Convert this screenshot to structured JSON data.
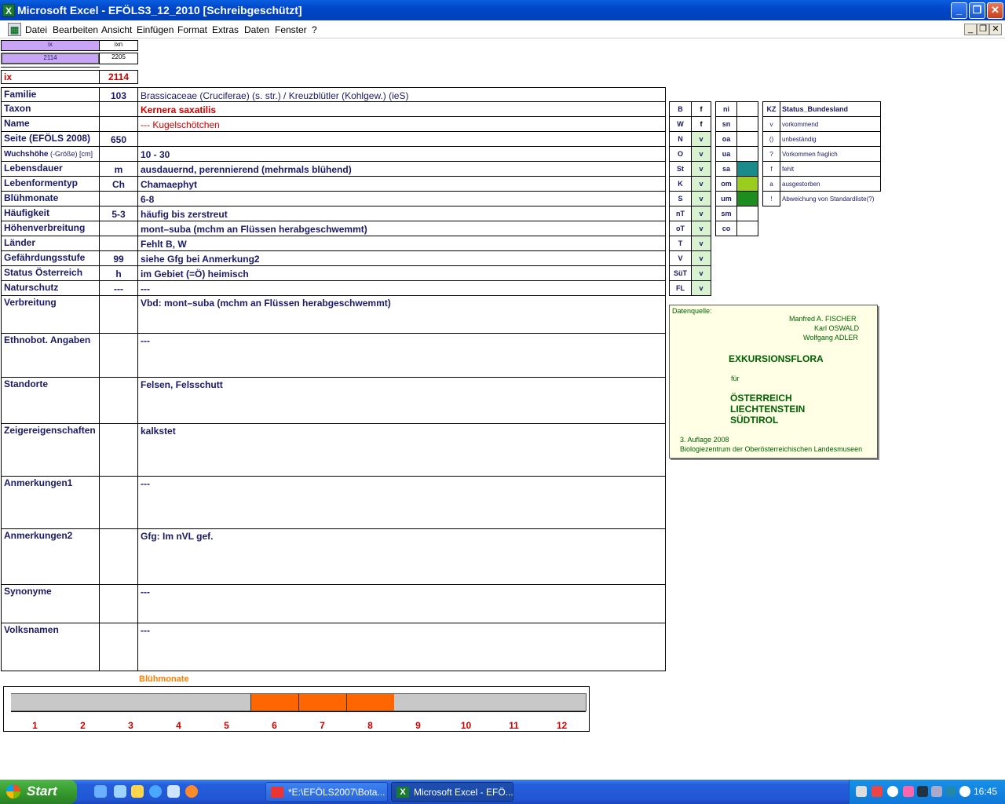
{
  "window": {
    "title": "Microsoft Excel - EFÖLS3_12_2010  [Schreibgeschützt]",
    "app_icon": "excel-icon",
    "buttons": [
      "minimize",
      "restore",
      "close"
    ]
  },
  "menu": {
    "items": [
      "Datei",
      "Bearbeiten",
      "Ansicht",
      "Einfügen",
      "Format",
      "Extras",
      "Daten",
      "Fenster",
      "?"
    ]
  },
  "topcells": {
    "ix_head": "ix",
    "ixn_head": "ixn",
    "ix_val": "2114",
    "ixn_val": "2205",
    "ix_label": "ix",
    "ix_number": "2114"
  },
  "rows": [
    {
      "label": "Familie",
      "code": "103",
      "value": "Brassicaceae (Cruciferae) (s. str.)  /  Kreuzblütler (Kohlgew.) (ieS)"
    },
    {
      "label": "Taxon",
      "code": "",
      "value": "Kernera saxatilis"
    },
    {
      "label": "Name",
      "code": "",
      "value": "--- Kugelschötchen"
    },
    {
      "label": "Seite (EFÖLS 2008)",
      "code": "650",
      "value": ""
    },
    {
      "label": "Wuchshöhe",
      "label_suffix": " (-Größe) [cm]",
      "code": "",
      "value": " 10 - 30"
    },
    {
      "label": "Lebensdauer",
      "code": "m",
      "value": "ausdauernd, perennierend (mehrmals blühend)"
    },
    {
      "label": "Lebenformentyp",
      "code": "Ch",
      "value": "Chamaephyt"
    },
    {
      "label": "Blühmonate",
      "code": "",
      "value": " 6-8"
    },
    {
      "label": "Häufigkeit",
      "code": "5-3",
      "value": "häufig bis zerstreut"
    },
    {
      "label": "Höhenverbreitung",
      "code": "",
      "value": "mont–suba (mchm an Flüssen herabgeschwemmt)"
    },
    {
      "label": "Länder",
      "code": "",
      "value": "Fehlt B, W"
    },
    {
      "label": "Gefährdungsstufe",
      "code": "99",
      "value": "siehe Gfg bei Anmerkung2"
    },
    {
      "label": "Status Österreich",
      "code": "h",
      "value": "im Gebiet (=Ö) heimisch"
    },
    {
      "label": "Naturschutz",
      "code": "---",
      "value": " ---"
    },
    {
      "label": "Verbreitung",
      "code": "",
      "value": "Vbd: mont–suba (mchm an Flüssen herabgeschwemmt)"
    },
    {
      "label": "Ethnobot. Angaben",
      "code": "",
      "value": "---"
    },
    {
      "label": "Standorte",
      "code": "",
      "value": "Felsen, Felsschutt"
    },
    {
      "label": "Zeigereigenschaften",
      "code": "",
      "value": "kalkstet"
    },
    {
      "label": "Anmerkungen1",
      "code": "",
      "value": "---"
    },
    {
      "label": "Anmerkungen2",
      "code": "",
      "value": "Gfg:  Im nVL gef."
    },
    {
      "label": "Synonyme",
      "code": "",
      "value": "---"
    },
    {
      "label": "Volksnamen",
      "code": "",
      "value": "---"
    }
  ],
  "bundeslaender": [
    {
      "code": "B",
      "val": "f"
    },
    {
      "code": "W",
      "val": "f"
    },
    {
      "code": "N",
      "val": "v"
    },
    {
      "code": "O",
      "val": "v"
    },
    {
      "code": "St",
      "val": "v"
    },
    {
      "code": "K",
      "val": "v"
    },
    {
      "code": "S",
      "val": "v"
    },
    {
      "code": "nT",
      "val": "v"
    },
    {
      "code": "oT",
      "val": "v"
    },
    {
      "code": "T",
      "val": "v"
    },
    {
      "code": "V",
      "val": "v"
    },
    {
      "code": "SüT",
      "val": "v"
    },
    {
      "code": "FL",
      "val": "v"
    }
  ],
  "hoehenstufen": [
    {
      "code": "ni",
      "color": ""
    },
    {
      "code": "sn",
      "color": ""
    },
    {
      "code": "oa",
      "color": ""
    },
    {
      "code": "ua",
      "color": ""
    },
    {
      "code": "sa",
      "color": "#1b8a8a"
    },
    {
      "code": "om",
      "color": "#9acd1e"
    },
    {
      "code": "um",
      "color": "#1e8c1e"
    },
    {
      "code": "sm",
      "color": ""
    },
    {
      "code": "co",
      "color": ""
    }
  ],
  "status_legend": {
    "head_kz": "KZ",
    "head_label": "Status_Bundesland",
    "items": [
      {
        "kz": "v",
        "text": "vorkommend"
      },
      {
        "kz": "()",
        "text": "unbeständig"
      },
      {
        "kz": "?",
        "text": "Vorkommen fraglich"
      },
      {
        "kz": "f",
        "text": "fehlt"
      },
      {
        "kz": "a",
        "text": "ausgestorben"
      },
      {
        "kz": "!",
        "text": "Abweichung von Standardliste(?)"
      }
    ]
  },
  "source": {
    "heading": "Datenquelle:",
    "authors": [
      "Manfred A. FISCHER",
      "Karl OSWALD",
      "Wolfgang ADLER"
    ],
    "title": "EXKURSIONSFLORA",
    "fuer": "für",
    "countries": [
      "ÖSTERREICH",
      "LIECHTENSTEIN",
      "SÜDTIROL"
    ],
    "edition": "3. Auflage 2008",
    "publisher": "Biologiezentrum der Oberösterreichischen Landesmuseen"
  },
  "bluete": {
    "title": "Blühmonate",
    "months": [
      "1",
      "2",
      "3",
      "4",
      "5",
      "6",
      "7",
      "8",
      "9",
      "10",
      "11",
      "12"
    ],
    "flowering": [
      6,
      7,
      8
    ],
    "on_color": "#ff6600",
    "off_color": "#c8c8c8"
  },
  "taskbar": {
    "start": "Start",
    "tasks": [
      "*E:\\EFÖLS2007\\Bota...",
      "Microsoft Excel - EFÖ..."
    ],
    "clock": "16:45"
  }
}
